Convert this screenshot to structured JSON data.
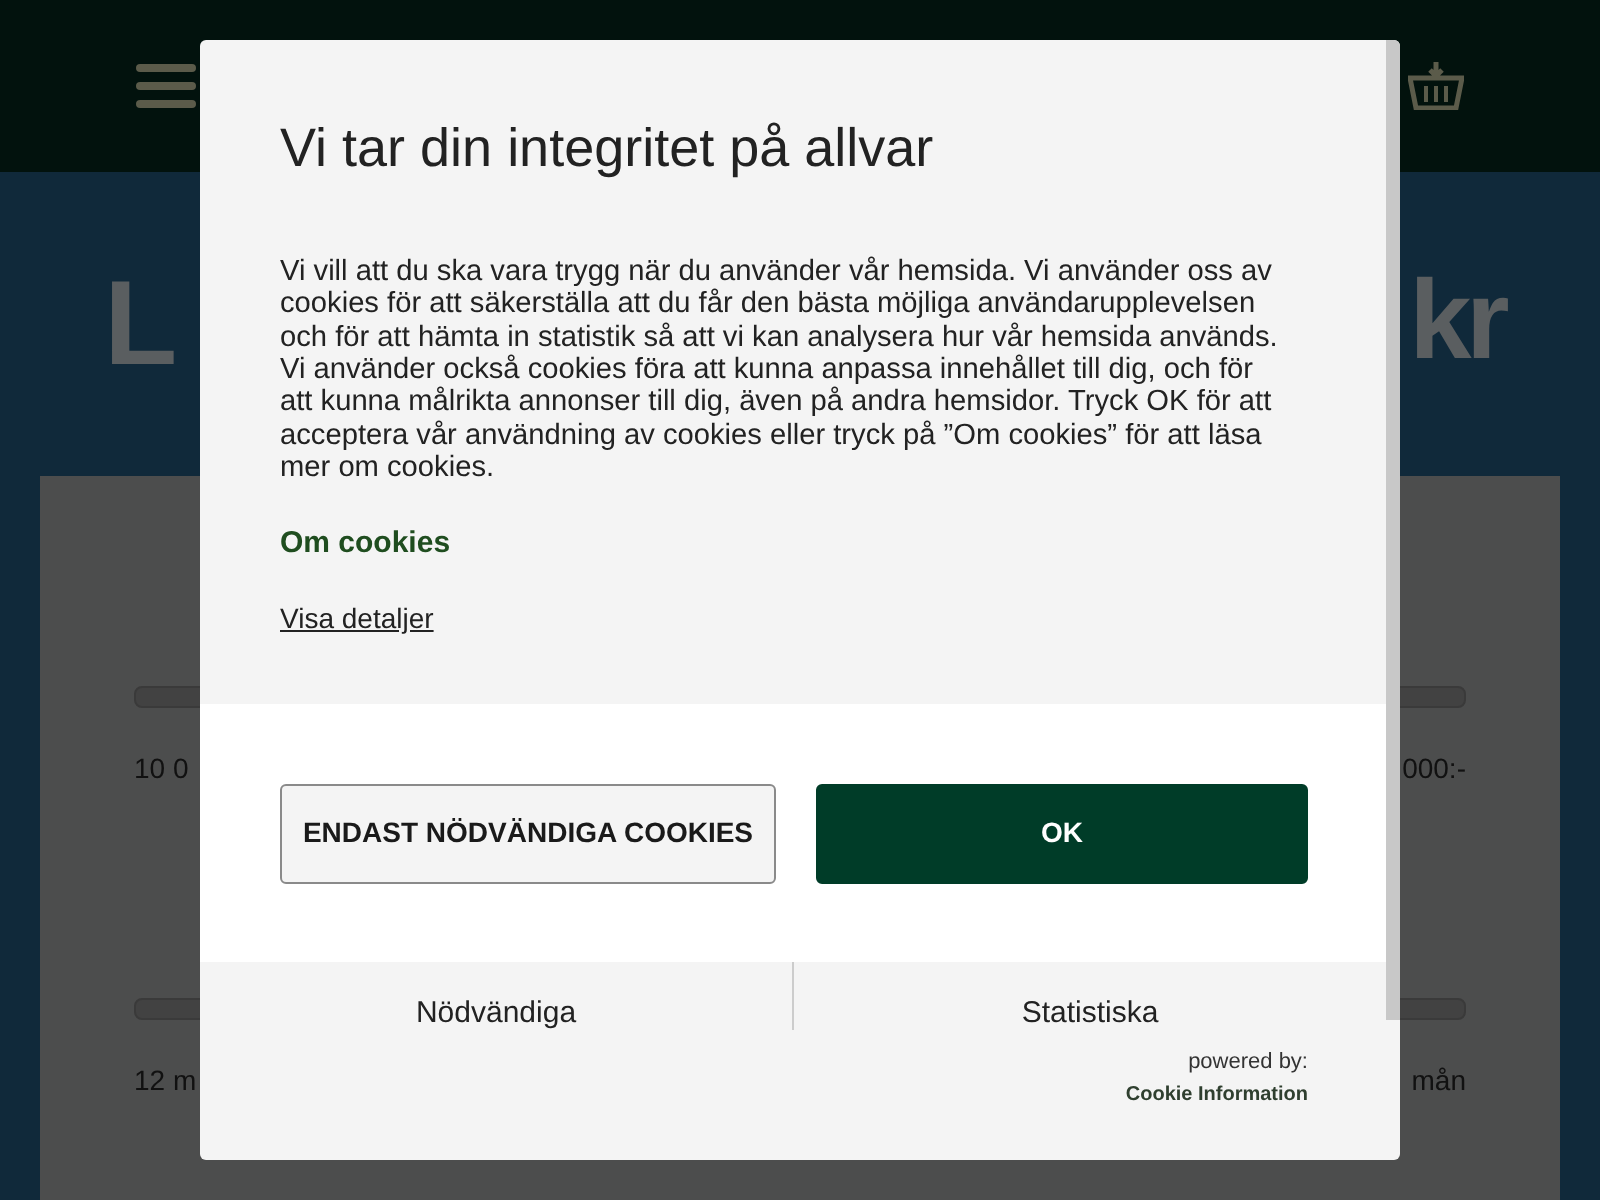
{
  "background": {
    "heading_left": "L",
    "heading_right": "kr",
    "amount_left": "10 0",
    "amount_right": "000:-",
    "months_left": "12 m",
    "months_right": "mån"
  },
  "dialog": {
    "title": "Vi tar din integritet på allvar",
    "body": "Vi vill att du ska vara trygg när du använder vår hemsida. Vi använder oss av cookies för att säkerställa att du får den bästa möjliga användarupplevelsen och för att hämta in statistik så att vi kan analysera hur vår hemsida används. Vi använder också cookies föra att kunna anpassa innehållet till dig, och för att kunna målrikta annonser till dig, även på andra hemsidor. Tryck OK för att acceptera vår användning av cookies eller tryck på ”Om cookies” för att läsa mer om cookies.",
    "about_link": "Om cookies",
    "details_link": "Visa detaljer",
    "buttons": [
      {
        "label": "ENDAST NÖDVÄNDIGA COOKIES",
        "kind": "secondary"
      },
      {
        "label": "OK",
        "kind": "primary"
      }
    ],
    "categories": [
      "Nödvändiga",
      "Statistiska"
    ],
    "powered_by": "powered by:",
    "provider": "Cookie Information"
  }
}
